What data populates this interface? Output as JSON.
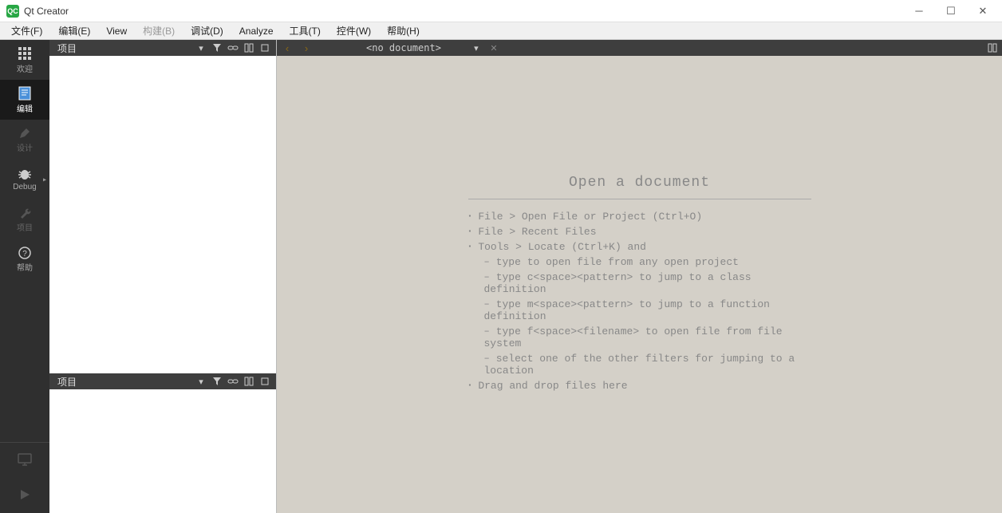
{
  "window": {
    "title": "Qt Creator"
  },
  "menu": {
    "file": "文件(F)",
    "edit": "编辑(E)",
    "view": "View",
    "build": "构建(B)",
    "debug": "调试(D)",
    "analyze": "Analyze",
    "tools": "工具(T)",
    "widgets": "控件(W)",
    "help": "帮助(H)"
  },
  "sidebar": {
    "welcome": "欢迎",
    "edit": "编辑",
    "design": "设计",
    "debug": "Debug",
    "projects": "项目",
    "help": "帮助"
  },
  "panel": {
    "title": "项目"
  },
  "editor": {
    "no_document": "<no document>"
  },
  "welcome": {
    "title": "Open a document",
    "items": [
      "File > Open File or Project (Ctrl+O)",
      "File > Recent Files",
      "Tools > Locate (Ctrl+K) and"
    ],
    "subitems": [
      "type to open file from any open project",
      "type c<space><pattern> to jump to a class definition",
      "type m<space><pattern> to jump to a function definition",
      "type f<space><filename> to open file from file system",
      "select one of the other filters for jumping to a location"
    ],
    "last": "Drag and drop files here"
  }
}
